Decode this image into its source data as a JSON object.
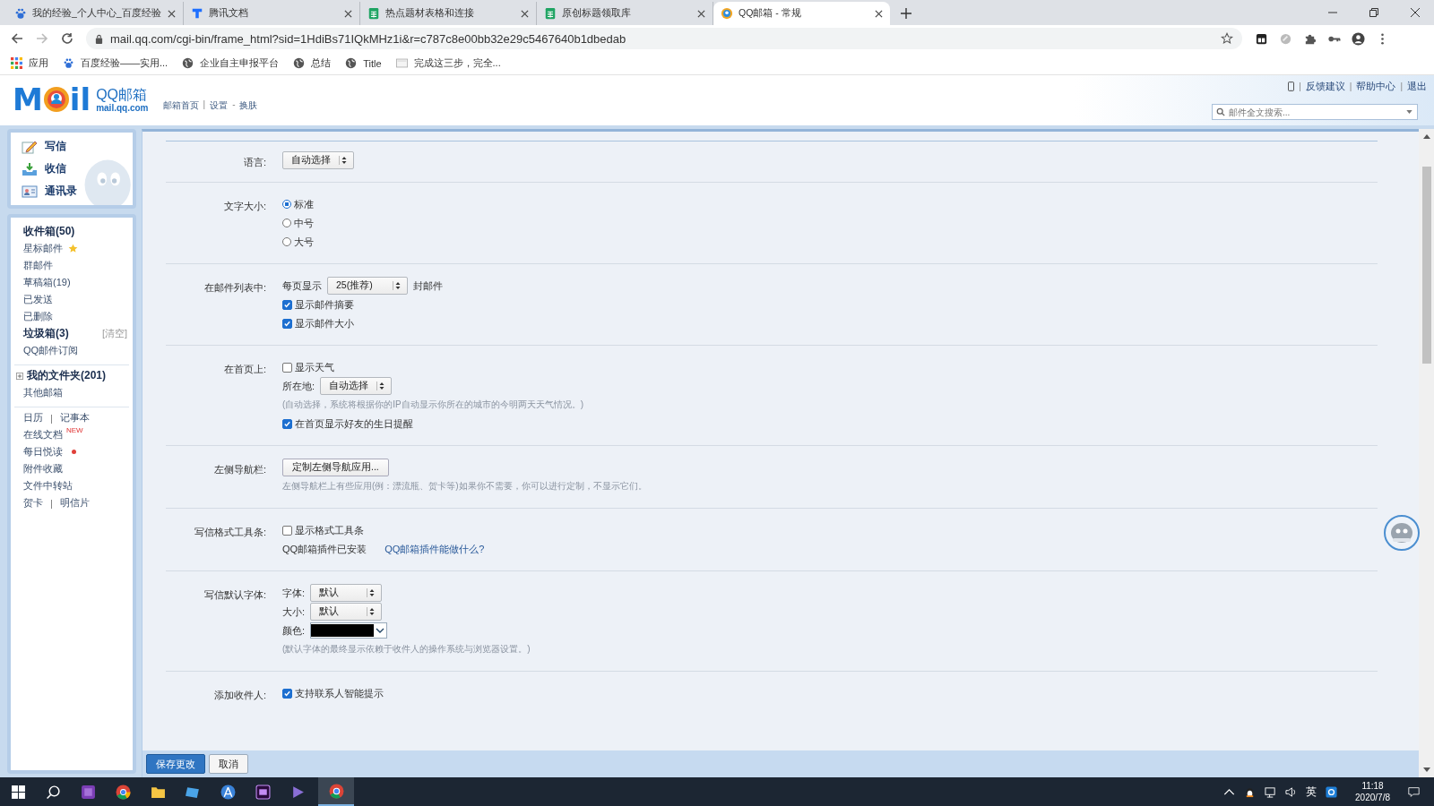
{
  "browser": {
    "tabs": [
      {
        "title": "我的经验_个人中心_百度经验",
        "kind": "paw",
        "selected": false
      },
      {
        "title": "腾讯文档",
        "kind": "doc",
        "selected": false
      },
      {
        "title": "热点题材表格和连接",
        "kind": "sheet",
        "selected": false
      },
      {
        "title": "原创标题领取库",
        "kind": "sheet",
        "selected": false
      },
      {
        "title": "QQ邮箱 - 常规",
        "kind": "mail",
        "selected": true
      }
    ],
    "address": "mail.qq.com/cgi-bin/frame_html?sid=1HdiBs71IQkMHz1i&r=c787c8e00bb32e29c5467640b1dbedab",
    "bookmarks": [
      {
        "label": "应用",
        "kind": "apps"
      },
      {
        "label": "百度经验——实用...",
        "kind": "paw"
      },
      {
        "label": "企业自主申报平台",
        "kind": "globe"
      },
      {
        "label": "总结",
        "kind": "globe"
      },
      {
        "label": "Title",
        "kind": "globe"
      },
      {
        "label": "完成这三步，完全...",
        "kind": "page"
      }
    ]
  },
  "mail": {
    "logo": {
      "mark_left": "M",
      "mark_right": "il",
      "name": "QQ邮箱",
      "domain": "mail.qq.com"
    },
    "nav_links": [
      {
        "label": "邮箱首页"
      },
      {
        "separator": "|",
        "label": "设置"
      },
      {
        "separator": "-",
        "label": "换肤"
      }
    ],
    "top_links": [
      {
        "separator": "|",
        "label": "反馈建议"
      },
      {
        "separator": "|",
        "label": "帮助中心"
      },
      {
        "separator": "|",
        "label": "退出"
      }
    ],
    "search": {
      "placeholder": "邮件全文搜索..."
    },
    "quick_actions": [
      {
        "label": "写信",
        "kind": "pencil"
      },
      {
        "label": "收信",
        "kind": "inbox"
      },
      {
        "label": "通讯录",
        "kind": "contacts"
      }
    ],
    "folder_groups": [
      [
        {
          "kind": "plain",
          "label": "收件箱(50)",
          "bold": true
        },
        {
          "kind": "starred",
          "label": "星标邮件",
          "bold": false
        },
        {
          "kind": "plain",
          "label": "群邮件",
          "bold": false
        },
        {
          "kind": "plain",
          "label": "草稿箱(19)",
          "bold": false
        },
        {
          "kind": "plain",
          "label": "已发送",
          "bold": false
        },
        {
          "kind": "plain",
          "label": "已删除",
          "bold": false
        },
        {
          "kind": "plain",
          "label": "垃圾箱(3)",
          "bold": true,
          "action": "[清空]"
        },
        {
          "kind": "plain",
          "label": "QQ邮件订阅",
          "bold": false
        }
      ],
      [
        {
          "kind": "plain",
          "label": "我的文件夹(201)",
          "bold": true,
          "expanded": false
        },
        {
          "kind": "plain",
          "label": "其他邮箱",
          "bold": false
        }
      ],
      [
        {
          "kind": "pair",
          "pair": [
            "日历",
            "记事本"
          ],
          "separator": "|"
        },
        {
          "kind": "plain",
          "label": "在线文档",
          "bold": false,
          "badge": "NEW"
        },
        {
          "kind": "dotted",
          "label": "每日悦读",
          "bold": false
        },
        {
          "kind": "plain",
          "label": "附件收藏",
          "bold": false
        },
        {
          "kind": "plain",
          "label": "文件中转站",
          "bold": false
        },
        {
          "kind": "pair",
          "pair": [
            "贺卡",
            "明信片"
          ],
          "separator": "|"
        }
      ]
    ],
    "settings": [
      {
        "label": "语言:",
        "lines": [
          [
            {
              "kind": "select",
              "value": "自动选择"
            }
          ]
        ]
      },
      {
        "label": "文字大小:",
        "lines": [
          [
            {
              "kind": "radio",
              "label": "标准",
              "selected": true
            }
          ],
          [
            {
              "kind": "radio",
              "label": "中号",
              "selected": false
            }
          ],
          [
            {
              "kind": "radio",
              "label": "大号",
              "selected": false
            }
          ]
        ]
      },
      {
        "label": "在邮件列表中:",
        "lines": [
          [
            {
              "kind": "text",
              "text": "每页显示"
            },
            {
              "kind": "select",
              "value": "25(推荐)"
            },
            {
              "kind": "text",
              "text": "封邮件"
            }
          ],
          [
            {
              "kind": "checkbox",
              "label": "显示邮件摘要",
              "checked": true
            }
          ],
          [
            {
              "kind": "checkbox",
              "label": "显示邮件大小",
              "checked": true
            }
          ]
        ]
      },
      {
        "label": "在首页上:",
        "lines": [
          [
            {
              "kind": "checkbox",
              "label": "显示天气",
              "checked": false
            }
          ],
          [
            {
              "kind": "text",
              "text": "所在地:"
            },
            {
              "kind": "select",
              "value": "自动选择"
            }
          ],
          [
            {
              "kind": "hint",
              "text": "(自动选择，系统将根据你的IP自动显示你所在的城市的今明两天天气情况。)"
            }
          ],
          [
            {
              "kind": "checkbox",
              "label": "在首页显示好友的生日提醒",
              "checked": true
            }
          ]
        ]
      },
      {
        "label": "左侧导航栏:",
        "lines": [
          [
            {
              "kind": "button",
              "label": "定制左侧导航应用..."
            }
          ],
          [
            {
              "kind": "hint",
              "text": "左侧导航栏上有些应用(例：漂流瓶、贺卡等)如果你不需要，你可以进行定制，不显示它们。"
            }
          ]
        ]
      },
      {
        "label": "写信格式工具条:",
        "lines": [
          [
            {
              "kind": "checkbox",
              "label": "显示格式工具条",
              "checked": false
            }
          ],
          [
            {
              "kind": "text",
              "text": "QQ邮箱插件已安装"
            },
            {
              "kind": "link",
              "label": "QQ邮箱插件能做什么?"
            }
          ]
        ]
      },
      {
        "label": "写信默认字体:",
        "lines": [
          [
            {
              "kind": "text",
              "text": "字体:"
            },
            {
              "kind": "select",
              "value": "默认"
            }
          ],
          [
            {
              "kind": "text",
              "text": "大小:"
            },
            {
              "kind": "select",
              "value": "默认"
            }
          ],
          [
            {
              "kind": "text",
              "text": "颜色:"
            },
            {
              "kind": "color",
              "color": "#000000"
            }
          ],
          [
            {
              "kind": "hint",
              "text": "(默认字体的最终显示依赖于收件人的操作系统与浏览器设置。)"
            }
          ]
        ]
      },
      {
        "label": "添加收件人:",
        "lines": [
          [
            {
              "kind": "checkbox",
              "label": "支持联系人智能提示",
              "checked": true
            }
          ]
        ]
      }
    ],
    "footer_buttons": [
      {
        "label": "保存更改",
        "primary": true
      },
      {
        "label": "取消",
        "primary": false
      }
    ]
  },
  "taskbar": {
    "input_method": "英",
    "time": "11:18",
    "date": "2020/7/8"
  }
}
